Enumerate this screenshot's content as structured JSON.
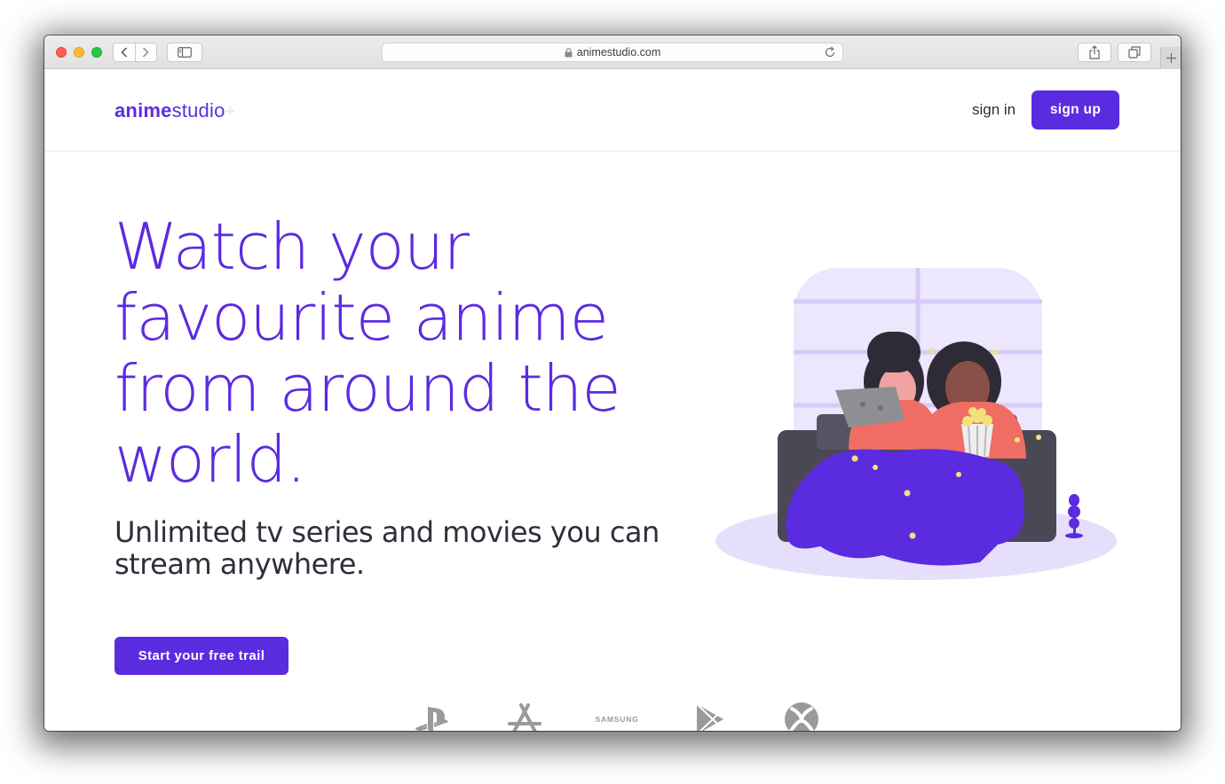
{
  "browser": {
    "url": "animestudio.com"
  },
  "header": {
    "logo_bold": "anime",
    "logo_light": "studio",
    "logo_plus": "+",
    "signin_label": "sign in",
    "signup_label": "sign up"
  },
  "hero": {
    "title": "Watch your favourite anime from around the world.",
    "subtitle": "Unlimited tv series and movies you can stream anywhere.",
    "cta_label": "Start your free trail"
  },
  "platforms": [
    {
      "icon": "playstation-icon"
    },
    {
      "icon": "app-store-icon"
    },
    {
      "icon": "samsung-logo",
      "text": "SAMSUNG"
    },
    {
      "icon": "google-play-icon"
    },
    {
      "icon": "xbox-icon"
    }
  ],
  "colors": {
    "brand": "#5b2be0",
    "text_dark": "#2d2f3a",
    "logo_gray": "#9a9a9a"
  }
}
